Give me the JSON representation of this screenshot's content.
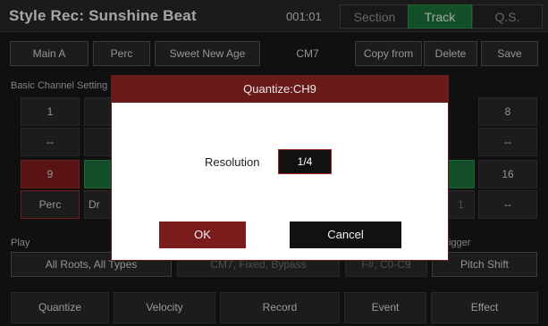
{
  "header": {
    "title": "Style Rec: Sunshine Beat",
    "time": "001:01",
    "tabs": [
      {
        "label": "Section"
      },
      {
        "label": "Track"
      },
      {
        "label": "Q.S."
      }
    ]
  },
  "toolbar": {
    "section": "Main A",
    "track": "Perc",
    "style_name": "Sweet New Age",
    "chord": "CM7",
    "copy_from": "Copy from",
    "delete": "Delete",
    "save": "Save"
  },
  "channels": {
    "label": "Basic Channel Setting",
    "row1": [
      {
        "num": "1",
        "val": "--"
      },
      {
        "num": "8",
        "val": "--"
      }
    ],
    "row2": [
      {
        "num": "9",
        "val": "Perc"
      },
      {
        "num": "16",
        "val": "--"
      }
    ],
    "partial_dr": "Dr",
    "partial_1": "1"
  },
  "play": {
    "label": "Play",
    "trigger_label": "Trigger",
    "roots": "All Roots, All Types",
    "source": "CM7, Fixed, Bypass",
    "range": "F#, C0-C9",
    "shift": "Pitch Shift"
  },
  "bottom": {
    "quantize": "Quantize",
    "velocity": "Velocity",
    "record": "Record",
    "event": "Event",
    "effect": "Effect"
  },
  "dialog": {
    "title": "Quantize:CH9",
    "resolution_label": "Resolution",
    "resolution_value": "1/4",
    "ok": "OK",
    "cancel": "Cancel"
  }
}
